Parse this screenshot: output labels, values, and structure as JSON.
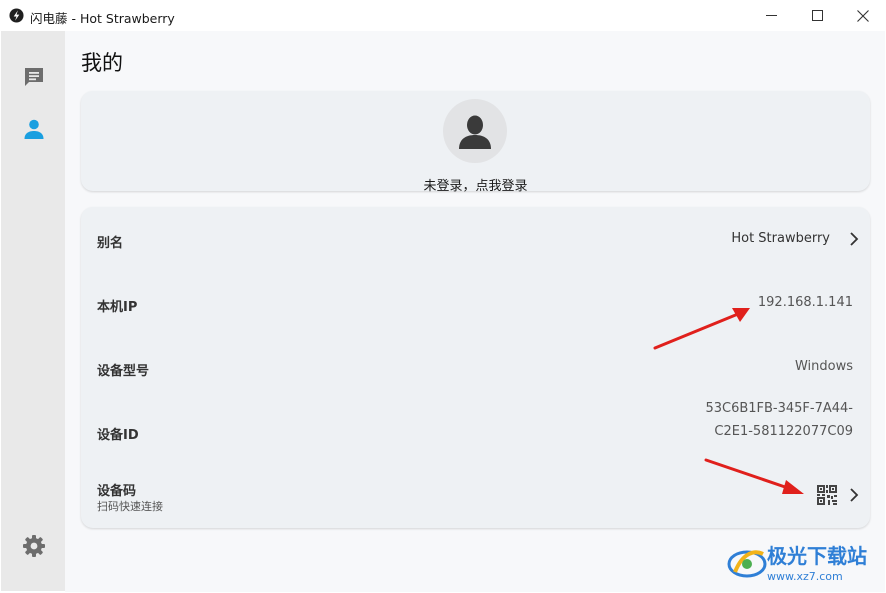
{
  "window": {
    "title": "闪电藤 - Hot Strawberry"
  },
  "sidebar": {
    "items": [
      {
        "icon": "chat-icon",
        "active": false
      },
      {
        "icon": "person-icon",
        "active": true
      }
    ],
    "settings_icon": "gear-icon"
  },
  "page": {
    "title": "我的"
  },
  "profile": {
    "login_prompt": "未登录，点我登录"
  },
  "info": {
    "alias_label": "别名",
    "alias_value": "Hot Strawberry",
    "ip_label": "本机IP",
    "ip_value": "192.168.1.141",
    "model_label": "设备型号",
    "model_value": "Windows",
    "id_label": "设备ID",
    "id_value_line1": "53C6B1FB-345F-7A44-",
    "id_value_line2": "C2E1-581122077C09",
    "code_label": "设备码",
    "code_sub": "扫码快速连接"
  },
  "watermark": {
    "text": "极光下载站",
    "url": "www.xz7.com"
  },
  "colors": {
    "accent": "#1a9fe0",
    "sidebar_bg": "#e9e9e9",
    "card_bg": "#eef1f4",
    "arrow": "#e0201c"
  }
}
